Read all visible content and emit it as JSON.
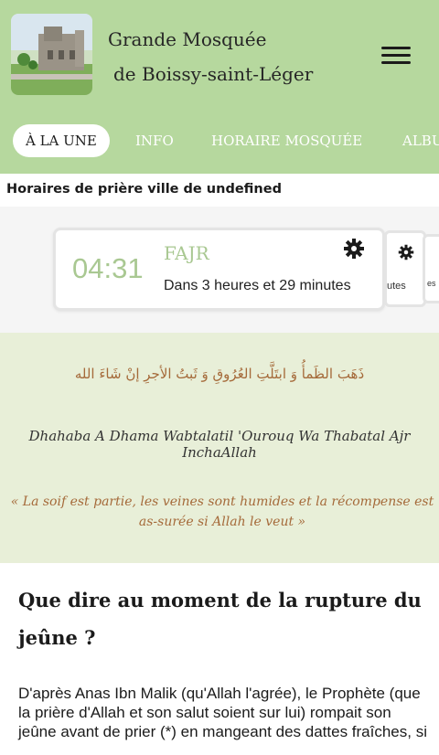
{
  "header": {
    "title_line1": "Grande Mosquée",
    "title_line2": "de Boissy-saint-Léger",
    "background": "#b6d89e",
    "menu_icon": "hamburger-menu-icon"
  },
  "tabs": [
    {
      "label": "À LA UNE",
      "active": true
    },
    {
      "label": "INFO",
      "active": false
    },
    {
      "label": "HORAIRE MOSQUÉE",
      "active": false
    },
    {
      "label": "ALBU",
      "active": false
    }
  ],
  "prayer": {
    "heading": "Horaires de prière ville de undefined",
    "next": {
      "time": "04:31",
      "name": "FAJR",
      "countdown": "Dans 3 heures et 29 minutes",
      "settings_icon": "gear-icon"
    },
    "peek_cards": [
      {
        "fragment": "utes"
      },
      {
        "fragment": "es"
      }
    ],
    "accent": "#a9c892"
  },
  "dua": {
    "arabic": "ذَهَبَ الظَمأُ وَ ابتَلَّتِ العُرُوقِ وَ ثَبتُ الأجرِ إنْ شَاءَ الله",
    "transliteration": "Dhahaba A Dhama Wabtalatil 'Ourouq Wa Thabatal Ajr InchaAllah",
    "translation": "« La soif est partie, les veines sont humides et la récompense est as-surée si Allah le veut »",
    "accent": "#a56a3a"
  },
  "article": {
    "title": "Que dire au moment de la rupture du jeûne ?",
    "body": "D'après Anas Ibn Malik (qu'Allah l'agrée), le Prophète (que la prière d'Allah et son salut soient sur lui) rompait son jeûne avant de prier (*) en mangeant des dattes fraîches, si"
  }
}
